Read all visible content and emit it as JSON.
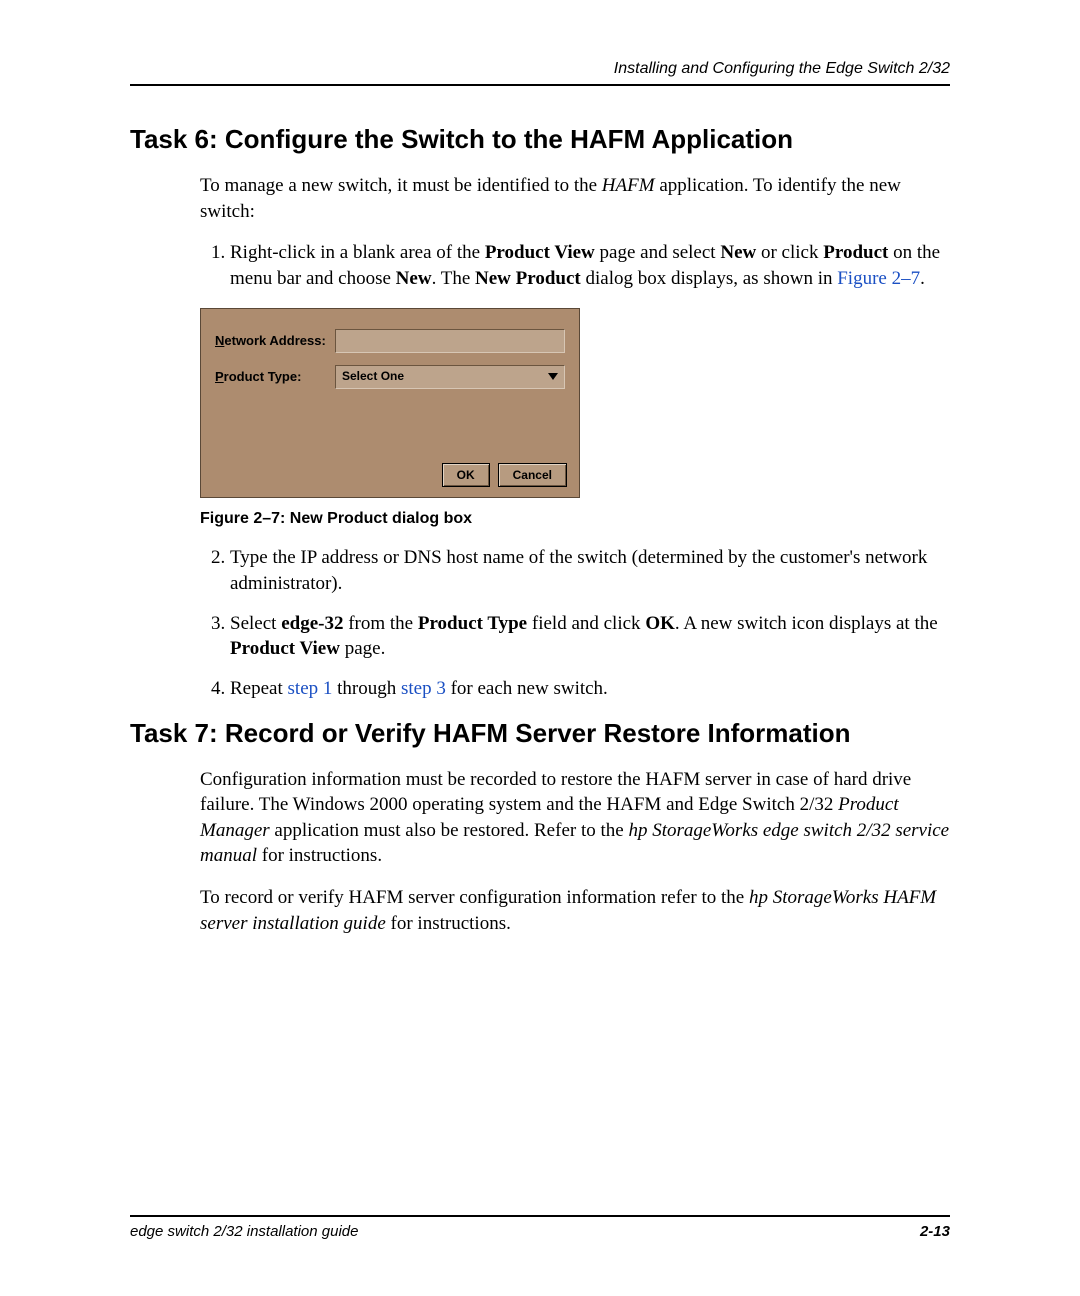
{
  "runningHeader": "Installing and Configuring the Edge Switch 2/32",
  "task6": {
    "title": "Task 6: Configure the Switch to the HAFM Application",
    "introA": "To manage a new switch, it must be identified to the ",
    "introItalic": "HAFM",
    "introB": " application. To identify the new switch:",
    "step1a": "Right-click in a blank area of the ",
    "step1b": "Product View",
    "step1c": " page and select ",
    "step1d": "New",
    "step1e": " or click ",
    "step1f": "Product",
    "step1g": " on the menu bar and choose ",
    "step1h": "New",
    "step1i": ". The ",
    "step1j": "New Product",
    "step1k": " dialog box displays, as shown in ",
    "step1link": "Figure 2–7",
    "step1l": ".",
    "step2": "Type the IP address or DNS host name of the switch (determined by the customer's network administrator).",
    "step3a": "Select ",
    "step3b": "edge-32",
    "step3c": " from the ",
    "step3d": "Product Type",
    "step3e": " field and click ",
    "step3f": "OK",
    "step3g": ". A new switch icon displays at the ",
    "step3h": "Product View",
    "step3i": " page.",
    "step4a": "Repeat ",
    "step4link1": "step 1",
    "step4b": " through ",
    "step4link2": "step 3",
    "step4c": " for each new switch.",
    "figCaption": "Figure 2–7:  New Product dialog box",
    "dialog": {
      "networkLabelUL": "N",
      "networkLabelRest": "etwork Address:",
      "productLabelUL": "P",
      "productLabelRest": "roduct Type:",
      "selectValue": "Select One",
      "ok": "OK",
      "cancel": "Cancel"
    }
  },
  "task7": {
    "title": "Task 7: Record or Verify HAFM Server Restore Information",
    "p1a": "Configuration information must be recorded to restore the HAFM server in case of hard drive failure. The Windows 2000 operating system and the HAFM and Edge Switch 2/32 ",
    "p1i1": "Product Manager",
    "p1b": " application must also be restored. Refer to the ",
    "p1i2": "hp StorageWorks edge switch 2/32 service manual",
    "p1c": " for instructions.",
    "p2a": "To record or verify HAFM server configuration information refer to the ",
    "p2i1": "hp StorageWorks HAFM server installation guide",
    "p2b": " for instructions."
  },
  "footer": {
    "left": "edge switch 2/32 installation guide",
    "right": "2-13"
  }
}
